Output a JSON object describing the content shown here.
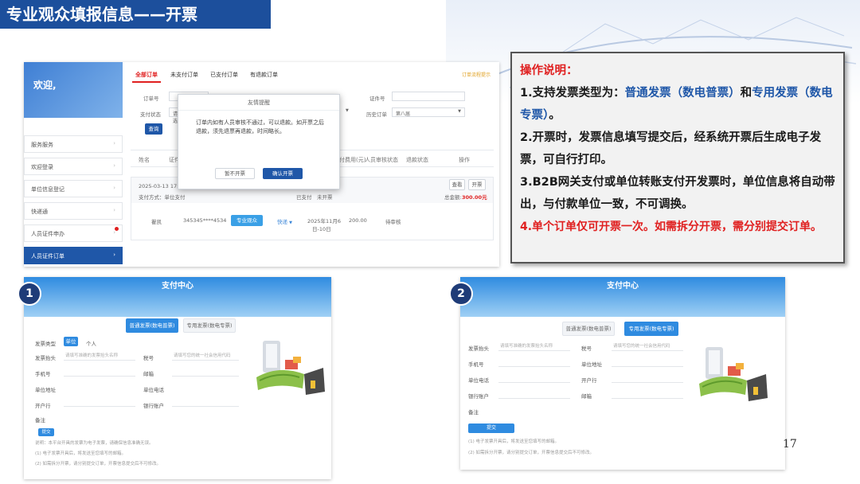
{
  "slide_title": "专业观众填报信息——开票",
  "page_number": "17",
  "orders_screen": {
    "welcome": "欢迎,",
    "sidebar": [
      {
        "label": "服务服务",
        "active": false,
        "dot": false
      },
      {
        "label": "欢迎登录",
        "active": false,
        "dot": false
      },
      {
        "label": "单位信息登记",
        "active": false,
        "dot": false
      },
      {
        "label": "快递通",
        "active": false,
        "dot": false
      },
      {
        "label": "人员证件申办",
        "active": false,
        "dot": true
      },
      {
        "label": "人员证件订单",
        "active": true,
        "dot": false
      }
    ],
    "tabs": [
      "全部订单",
      "未支付订单",
      "已支付订单",
      "有退款订单"
    ],
    "tab_right": "订单流程提示",
    "filters": {
      "order_no": "订单号",
      "cert_no": "证件号",
      "pay_status": "支付状态",
      "pay_status_value": "请选",
      "history": "历史订单",
      "history_value": "第八届"
    },
    "query_button": "查询",
    "table_headers": [
      "姓名",
      "证件",
      "付费用(元)",
      "人员审核状态",
      "退款状态",
      "操作"
    ],
    "order": {
      "datetime": "2025-03-13 17:24:1",
      "pay_method": "支付方式：单位支付",
      "status": "已支付",
      "invoice_status": "未开票",
      "view_button": "查看",
      "invoice_button": "开票",
      "total_label": "总金额:",
      "total_value": "300.00元",
      "name": "瞿凯",
      "id_no": "345345****4534",
      "cert_type": "专业观众",
      "delivery": "快递",
      "date_line1": "2025年11月6",
      "date_line2": "日-10日",
      "price": "200.00",
      "review": "待审核"
    },
    "modal": {
      "title": "友情提醒",
      "body": "订单内如有人员审核不通过，可以退款。如开票之后退款，须先退票再退款，时间略长。",
      "cancel": "暂不开票",
      "confirm": "确认开票"
    }
  },
  "instructions": {
    "title": "操作说明：",
    "item1_a": "1.支持发票类型为：",
    "item1_b": "普通发票（数电普票）",
    "item1_c": "和",
    "item1_d": "专用发票（数电专票）",
    "item1_e": "。",
    "item2": "2.开票时，发票信息填写提交后，经系统开票后生成电子发票，可自行打印。",
    "item3": "3.B2B网关支付或单位转账支付开发票时，单位信息将自动带出，与付款单位一致，不可调换。",
    "item4": "4.单个订单仅可开票一次。如需拆分开票，需分别提交订单。"
  },
  "pay1": {
    "badge": "1",
    "header": "支付中心",
    "tab_on": "普通发票(数电普票)",
    "tab_off": "专用发票(数电专票)",
    "invoice_type_label": "发票类型",
    "type_unit": "单位",
    "type_person": "个人",
    "title_label": "发票抬头",
    "title_placeholder": "请填写准确的发票抬头名称",
    "tax_label": "税号",
    "tax_placeholder": "请填写您的统一社会信用代码",
    "phone_label": "手机号",
    "email_label": "邮箱",
    "address_label": "单位地址",
    "unit_phone_label": "单位电话",
    "bank_label": "开户行",
    "account_label": "银行账户",
    "remark_label": "备注",
    "submit": "提交",
    "note1": "说明：本平台开具的发票为电子发票，请确保信息准确无误。",
    "note2": "(1) 电子发票开具后，将发送至您填写的邮箱。",
    "note3": "(2) 如需拆分开票，请分别提交订单，开票信息提交后不可修改。"
  },
  "pay2": {
    "badge": "2",
    "header": "支付中心",
    "tab_off": "普通发票(数电普票)",
    "tab_on": "专用发票(数电专票)",
    "title_label": "发票抬头",
    "title_placeholder": "请填写准确的发票抬头名称",
    "tax_label": "税号",
    "tax_placeholder": "请填写您的统一社会信用代码",
    "phone_label": "手机号",
    "address_label": "单位地址",
    "unit_phone_label": "单位电话",
    "bank_label": "开户行",
    "account_label": "银行账户",
    "email_label": "邮箱",
    "remark_label": "备注",
    "submit": "提交",
    "note1": "(1) 电子发票开具后，将发送至您填写的邮箱。",
    "note2": "(2) 如需拆分开票，请分别提交订单，开票信息提交后不可修改。"
  }
}
